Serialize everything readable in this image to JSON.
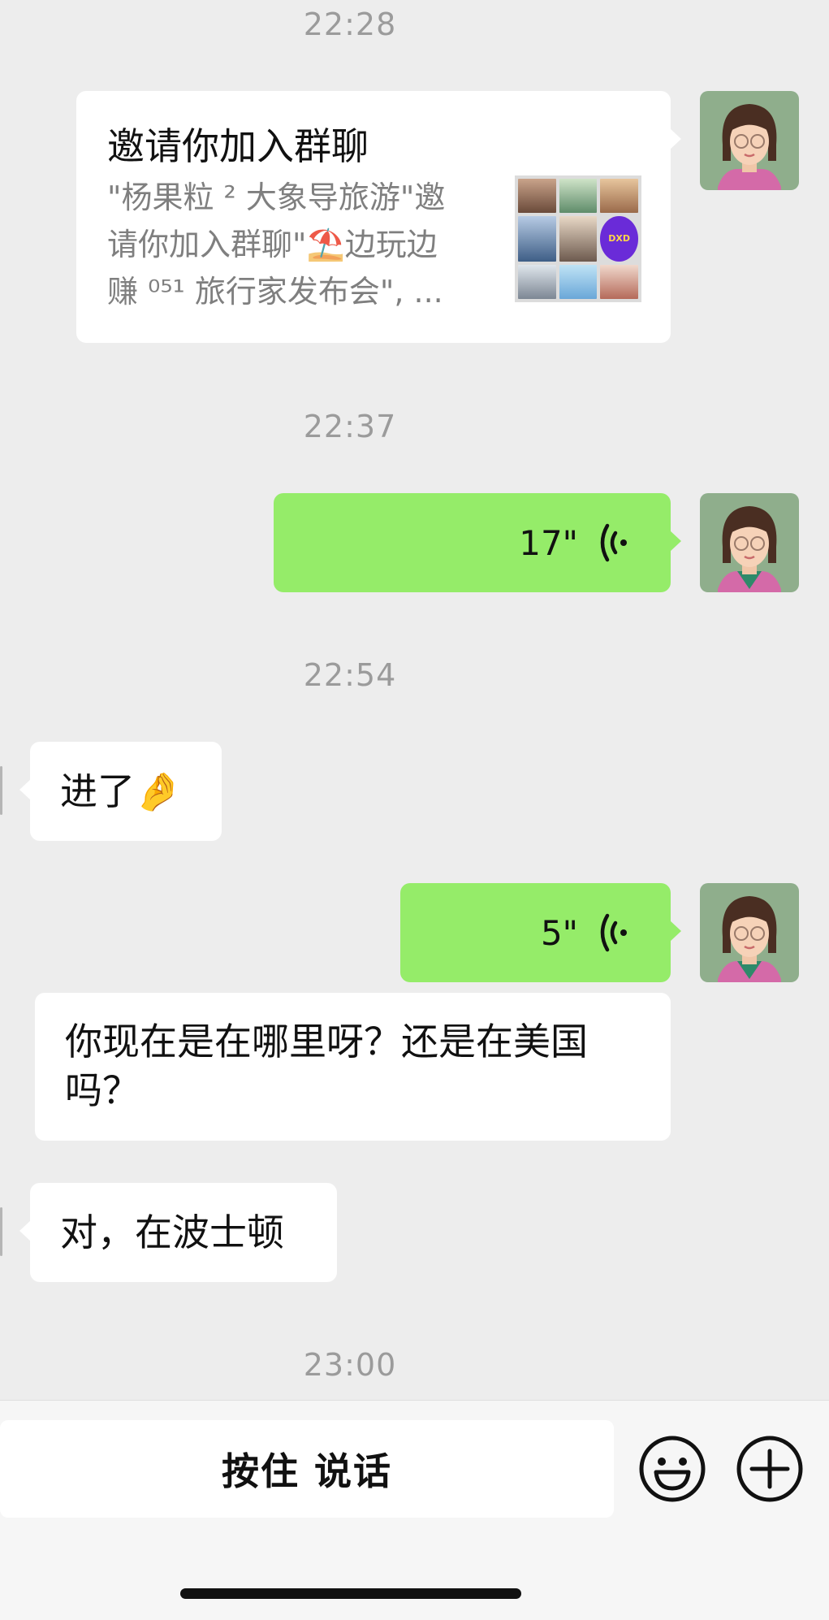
{
  "timestamps": [
    "22:28",
    "22:37",
    "22:54",
    "23:00"
  ],
  "invite_card": {
    "title": "邀请你加入群聊",
    "desc_line1": "\"杨果粒 ² 大象导旅游\"邀",
    "desc_line2": "请你加入群聊\"⛱️边玩边",
    "desc_line3": "赚 ⁰⁵¹ 旅行家发布会\", ...",
    "grid_badge": "DXD"
  },
  "voice_messages": [
    {
      "duration": "17\""
    },
    {
      "duration": "5\""
    }
  ],
  "messages": {
    "jinle": "进了🤌",
    "question_line1": "你现在是在哪里呀？还是在美国",
    "question_line2": "吗？",
    "answer": "对，在波士顿"
  },
  "input_bar": {
    "hold_to_talk": "按住 说话"
  },
  "colors": {
    "background": "#ededed",
    "sent_bubble": "#95ec69",
    "received_bubble": "#ffffff",
    "timestamp": "#9b9b9b"
  },
  "icons": [
    "wifi-voice-icon",
    "emoji-icon",
    "plus-icon"
  ]
}
